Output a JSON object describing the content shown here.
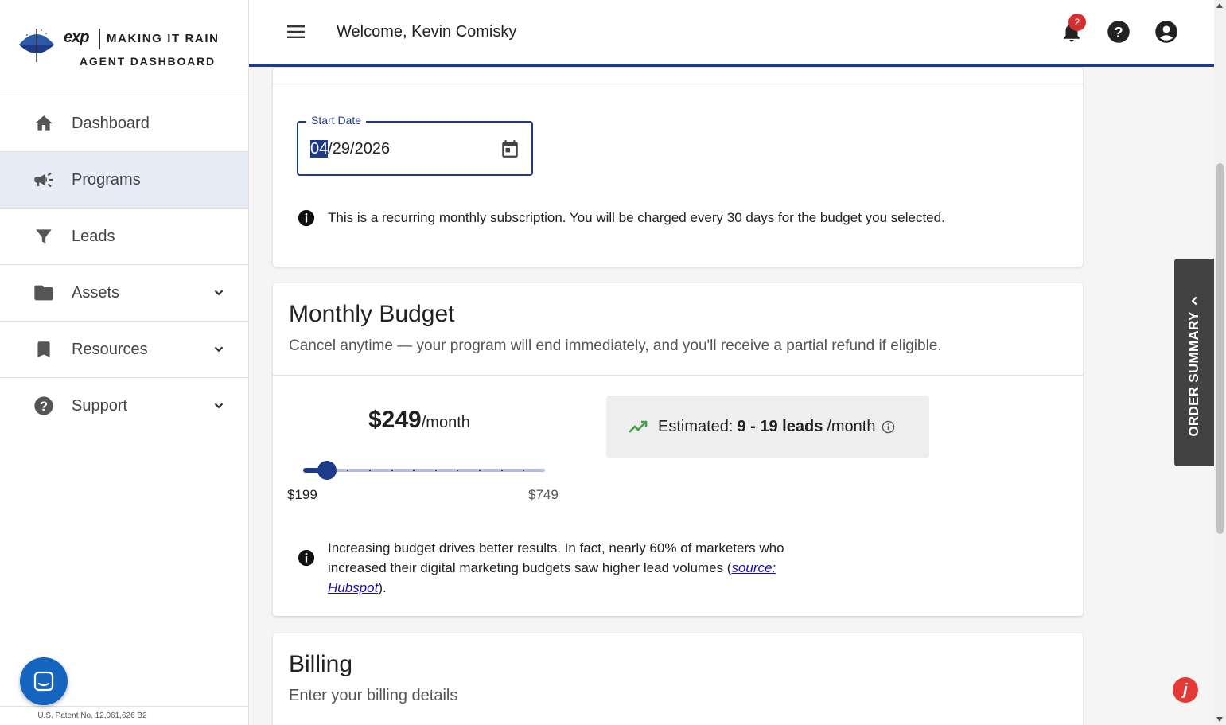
{
  "brand": {
    "exp_text": "exp",
    "line1": "MAKING IT RAIN",
    "line2": "AGENT DASHBOARD"
  },
  "sidebar": {
    "items": [
      {
        "label": "Dashboard",
        "icon": "home-icon"
      },
      {
        "label": "Programs",
        "icon": "megaphone-icon",
        "active": true
      },
      {
        "label": "Leads",
        "icon": "funnel-icon"
      },
      {
        "label": "Assets",
        "icon": "folder-icon",
        "expandable": true
      },
      {
        "label": "Resources",
        "icon": "bookmark-icon",
        "expandable": true
      },
      {
        "label": "Support",
        "icon": "help-circle-icon",
        "expandable": true
      }
    ],
    "patent": "U.S. Patent No. 12,061,626 B2"
  },
  "header": {
    "welcome": "Welcome, Kevin Comisky",
    "notification_count": "2"
  },
  "schedule": {
    "start_date_label": "Start Date",
    "start_date_month": "04",
    "start_date_rest": "/29/2026",
    "recurring_notice": "This is a recurring monthly subscription. You will be charged every 30 days for the budget you selected."
  },
  "budget": {
    "title": "Monthly Budget",
    "subtitle": "Cancel anytime — your program will end immediately, and you'll receive a partial refund if eligible.",
    "amount": "$249",
    "per": "/month",
    "slider_min_label": "$199",
    "slider_max_label": "$749",
    "slider_fraction": 0.0909,
    "slider_steps": 11,
    "estimate_prefix": "Estimated:",
    "estimate_value": "9 - 19 leads",
    "estimate_suffix": "/month",
    "tip_text": "Increasing budget drives better results. In fact, nearly 60% of marketers who increased their digital marketing budgets saw higher lead volumes (",
    "tip_link": "source: Hubspot",
    "tip_end": ")."
  },
  "billing": {
    "title": "Billing",
    "subtitle": "Enter your billing details"
  },
  "order_summary": {
    "label": "ORDER SUMMARY"
  },
  "colors": {
    "primary": "#1e3a8a",
    "badge": "#d32f2f",
    "chat": "#1565c0",
    "trend": "#43a047"
  }
}
